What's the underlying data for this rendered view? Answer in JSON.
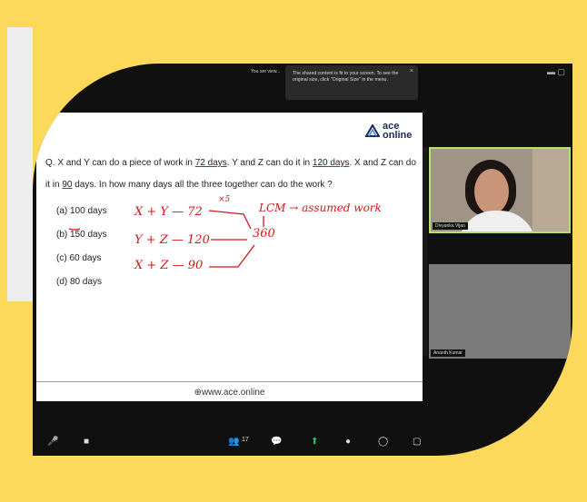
{
  "meeting": {
    "top_notice": "You are view...",
    "tooltip_text": "The shared content is fit to your screen. To see the original size, click \"Original Size\" in the menu.",
    "tooltip_close": "×"
  },
  "slide": {
    "logo_line1": "ace",
    "logo_line2": "online",
    "question_part1": "Q. X and Y can do a piece of work in ",
    "q_72": "72 days",
    "question_part2": ". Y and Z can do it in ",
    "q_120": "120 days",
    "question_part3": ". X and Z can do it in ",
    "q_90": "90",
    "question_part4": " days. In how many days all the three together can do the work ?",
    "options": [
      "(a) 100 days",
      "(b) 150 days",
      "(c) 60 days",
      "(d) 80 days"
    ],
    "footer": "www.ace.online",
    "handwriting": {
      "row1": "X + Y — 72",
      "row2": "Y + Z — 120",
      "row3": "X + Z — 90",
      "lcm": "LCM → assumed work",
      "total": "360",
      "mark": "×5"
    }
  },
  "participants": [
    {
      "name": "Divyanka Vijan"
    },
    {
      "name": "Ananth Kumar"
    }
  ],
  "toolbar": {
    "mic": "🎤",
    "video": "■",
    "participants": "👥",
    "participants_count": "17",
    "chat": "💬",
    "share": "⬆",
    "record": "●",
    "reactions": "◯",
    "apps": "▢"
  },
  "colors": {
    "accent": "#fcd95a",
    "ink": "#d01818",
    "speaker_border": "#b6e06e"
  }
}
